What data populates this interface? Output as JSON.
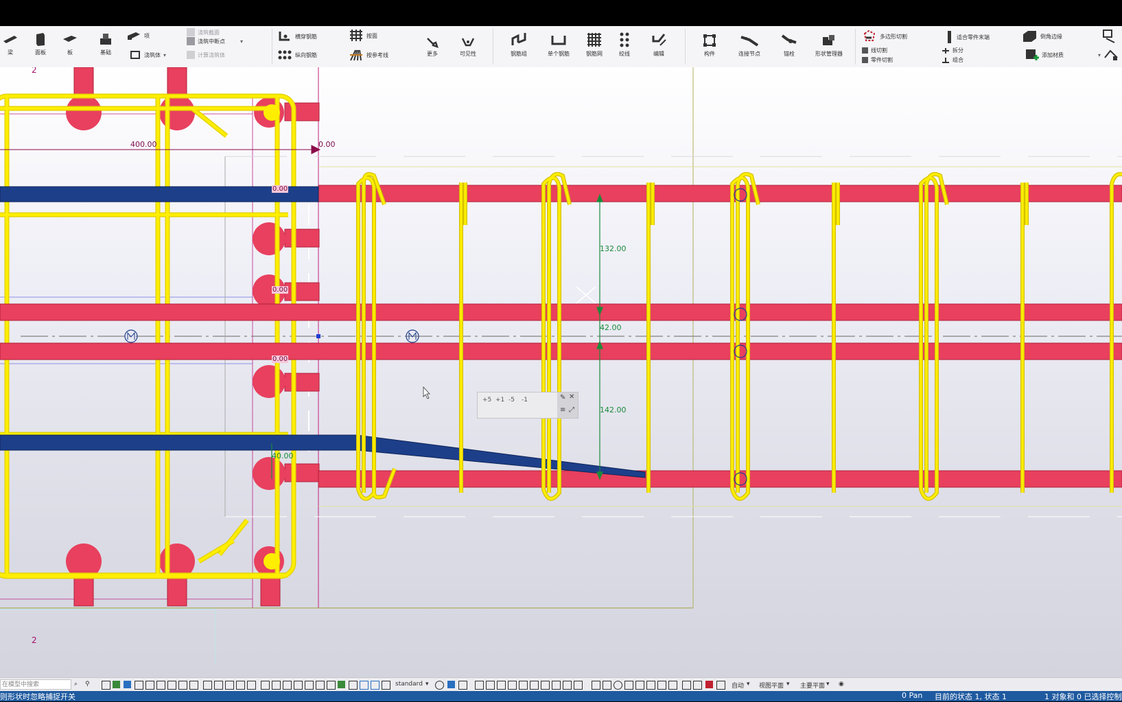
{
  "colors": {
    "ribbon_bg": "#f5f5f7",
    "rebar_yellow": "#ffee00",
    "rebar_red": "#e8405e",
    "rebar_blue": "#1d3f8a",
    "dim_green": "#1a8a3a",
    "grid_magenta": "#c02080",
    "status_bg": "#1e5aa0"
  },
  "ribbon": {
    "tools": [
      {
        "label": "梁",
        "icon": "beam-icon"
      },
      {
        "label": "面板",
        "icon": "panel-icon"
      },
      {
        "label": "板",
        "icon": "slab-icon"
      },
      {
        "label": "基础",
        "icon": "footing-icon"
      },
      {
        "label": "更多",
        "icon": "wrench-icon"
      },
      {
        "label": "可见性",
        "icon": "visibility-icon"
      },
      {
        "label": "钢筋组",
        "icon": "rebar-group-icon"
      },
      {
        "label": "单个钢筋",
        "icon": "single-rebar-icon"
      },
      {
        "label": "钢筋网",
        "icon": "mesh-icon"
      },
      {
        "label": "绞线",
        "icon": "strand-icon"
      },
      {
        "label": "编辑",
        "icon": "edit-rebar-icon"
      },
      {
        "label": "构件",
        "icon": "component-icon"
      },
      {
        "label": "连接节点",
        "icon": "connection-icon"
      },
      {
        "label": "锚栓",
        "icon": "anchor-icon"
      },
      {
        "label": "形状管理器",
        "icon": "shape-manager-icon"
      }
    ],
    "small": {
      "pour_object": "项",
      "pour_body": "浇筑体",
      "pour_break": "浇筑截面",
      "pour_midpoint": "浇筑中断点",
      "calc_pour": "计算浇筑体",
      "lateral_rebar": "横穿钢筋",
      "longitudinal_rebar": "纵向钢筋",
      "surface_treatment": "按面",
      "ref_line": "按参考线",
      "polygon_cut": "多边形切割",
      "line_cut": "线切割",
      "part_cut": "零件切割",
      "fit_part_end": "适合零件末端",
      "split": "拆分",
      "combine": "组合",
      "chamfer_edge": "倒角边缘",
      "add_material": "添加材质"
    }
  },
  "viewport": {
    "dimensions": {
      "d400": "400.00",
      "d0_top": "0.00",
      "d0_a": "0.00",
      "d0_b": "0.00",
      "d0_c": "0.00",
      "d40": "40.00",
      "d132": "132.00",
      "d42": "42.00",
      "d142": "142.00"
    },
    "grid_tag_top": "2",
    "grid_tag_bottom": "2"
  },
  "step_panel": {
    "steps": [
      "+5",
      "+1",
      "-5",
      "-1"
    ]
  },
  "bottom_toolbar": {
    "search_placeholder": "在模型中搜索",
    "standard": "standard",
    "auto": "自动",
    "view_plane": "视图平面",
    "main_plane": "主要平面"
  },
  "status": {
    "left": "则形状时忽略捕捉开关",
    "pan": "0 Pan",
    "state": "目前的状态 1, 状态 1",
    "selection": "1 对象和 0 已选择控制"
  }
}
